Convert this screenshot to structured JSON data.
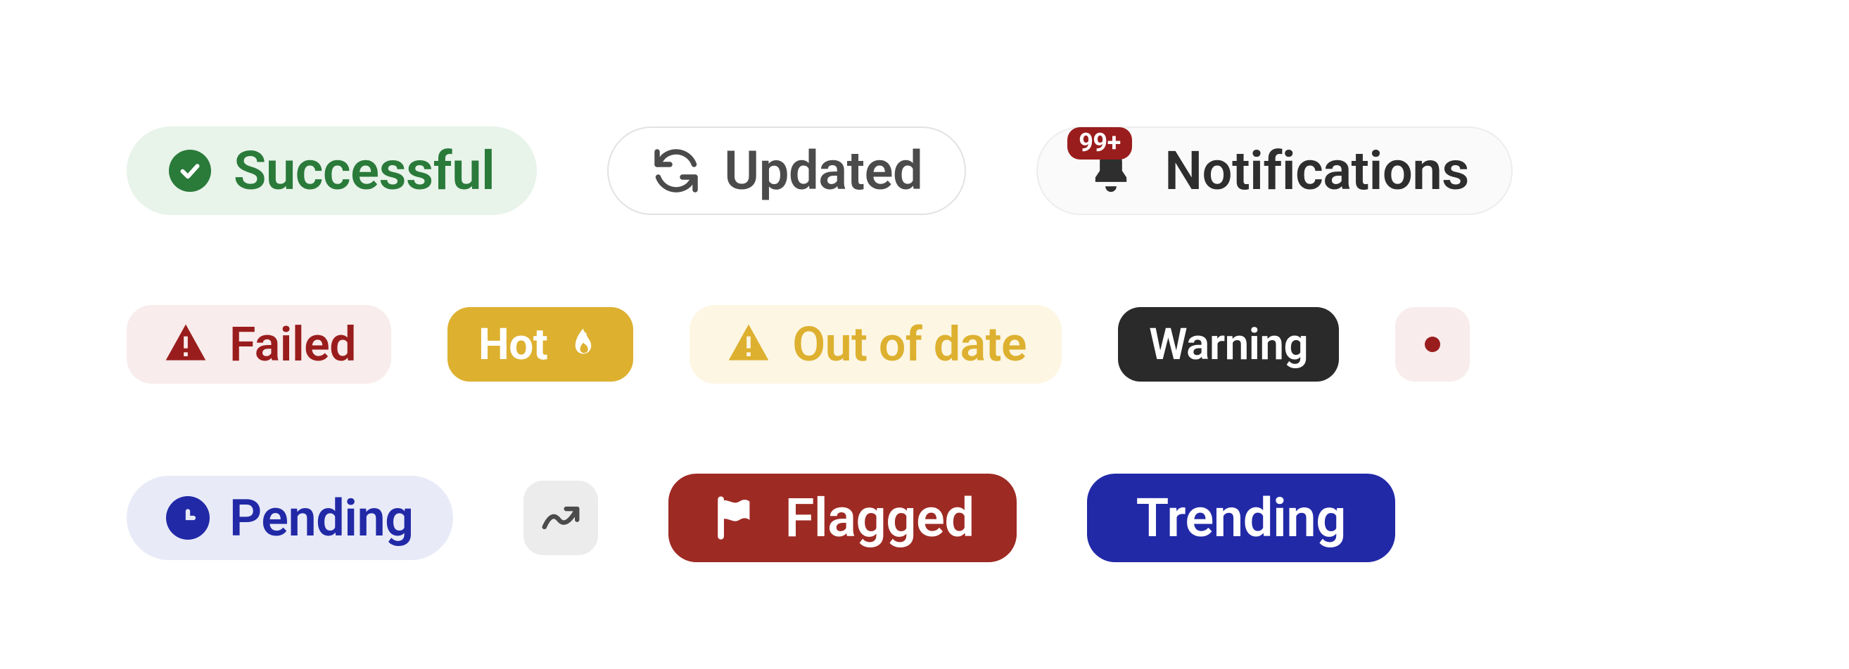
{
  "badges": {
    "successful": {
      "label": "Successful"
    },
    "updated": {
      "label": "Updated"
    },
    "notifications": {
      "label": "Notifications",
      "count": "99+"
    },
    "failed": {
      "label": "Failed"
    },
    "hot": {
      "label": "Hot"
    },
    "out_of_date": {
      "label": "Out of date"
    },
    "warning": {
      "label": "Warning"
    },
    "pending": {
      "label": "Pending"
    },
    "flagged": {
      "label": "Flagged"
    },
    "trending": {
      "label": "Trending"
    }
  },
  "colors": {
    "green": "#2a7a3a",
    "red": "#9a1d1d",
    "gold": "#ddb02f",
    "blue": "#2229a7",
    "charcoal": "#2a2a2a"
  }
}
